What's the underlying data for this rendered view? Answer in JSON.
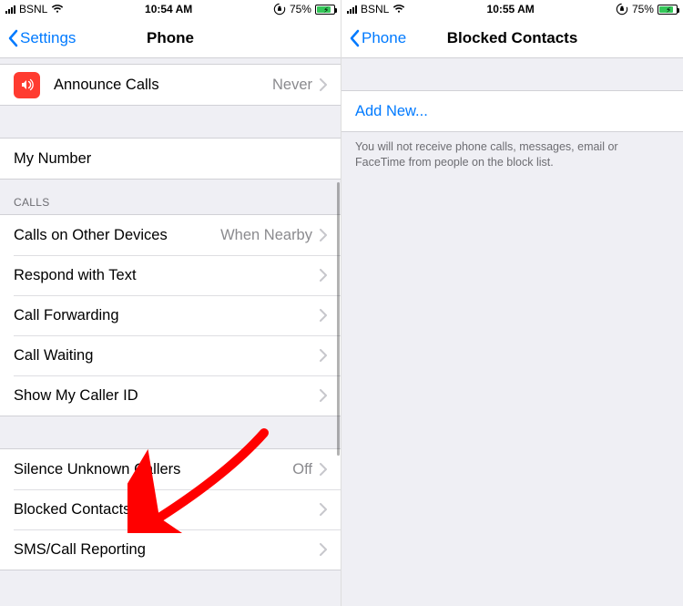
{
  "left": {
    "statusbar": {
      "carrier": "BSNL",
      "time": "10:54 AM",
      "battery_pct": "75%"
    },
    "nav": {
      "back": "Settings",
      "title": "Phone"
    },
    "announce": {
      "label": "Announce Calls",
      "value": "Never"
    },
    "my_number": {
      "label": "My Number"
    },
    "calls_header": "Calls",
    "calls": [
      {
        "label": "Calls on Other Devices",
        "value": "When Nearby"
      },
      {
        "label": "Respond with Text",
        "value": ""
      },
      {
        "label": "Call Forwarding",
        "value": ""
      },
      {
        "label": "Call Waiting",
        "value": ""
      },
      {
        "label": "Show My Caller ID",
        "value": ""
      }
    ],
    "misc": [
      {
        "label": "Silence Unknown Callers",
        "value": "Off"
      },
      {
        "label": "Blocked Contacts",
        "value": ""
      },
      {
        "label": "SMS/Call Reporting",
        "value": ""
      }
    ]
  },
  "right": {
    "statusbar": {
      "carrier": "BSNL",
      "time": "10:55 AM",
      "battery_pct": "75%"
    },
    "nav": {
      "back": "Phone",
      "title": "Blocked Contacts"
    },
    "add_new": "Add New...",
    "footer": "You will not receive phone calls, messages, email or FaceTime from people on the block list."
  }
}
